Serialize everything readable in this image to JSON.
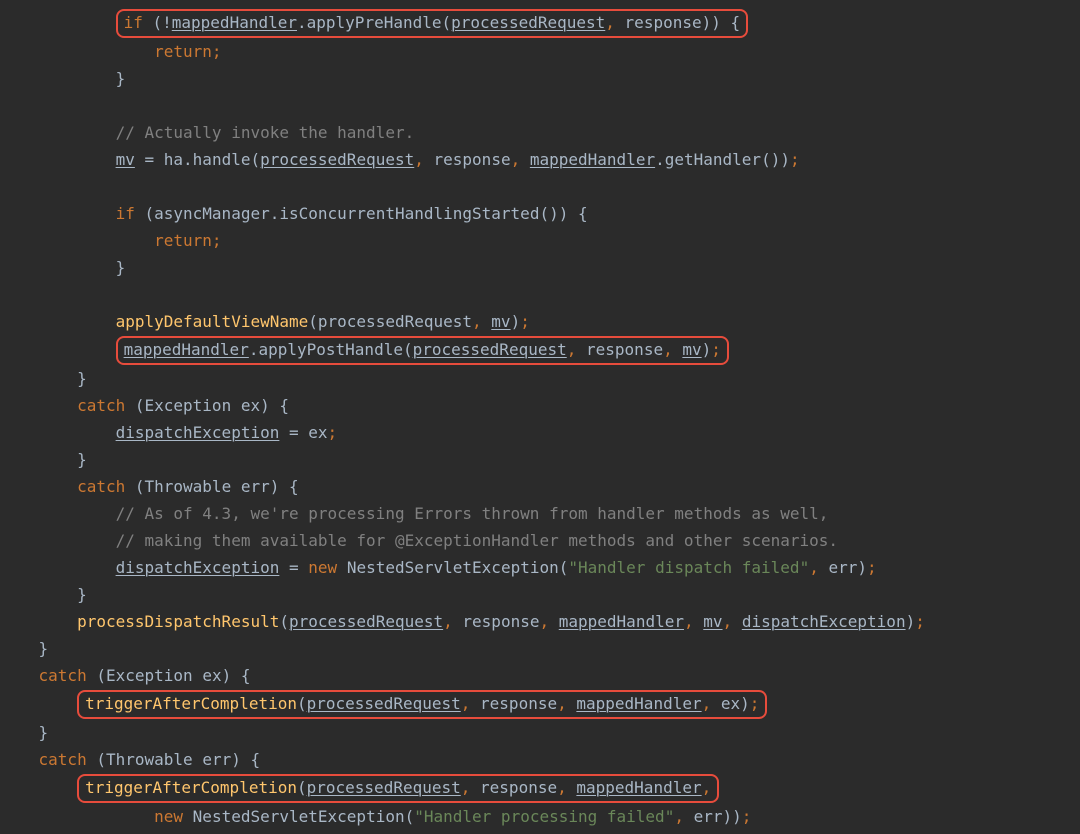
{
  "tokens": {
    "if": "if",
    "return": "return",
    "catch": "catch",
    "new": "new",
    "mappedHandler": "mappedHandler",
    "applyPreHandle": "applyPreHandle",
    "applyPostHandle": "applyPostHandle",
    "applyDefaultViewName": "applyDefaultViewName",
    "processedRequest": "processedRequest",
    "response": "response",
    "mv": "mv",
    "ha": "ha",
    "handle": "handle",
    "getHandler": "getHandler",
    "asyncManager": "asyncManager",
    "isConcurrentHandlingStarted": "isConcurrentHandlingStarted",
    "Exception": "Exception",
    "ex": "ex",
    "Throwable": "Throwable",
    "err": "err",
    "dispatchException": "dispatchException",
    "NestedServletException": "NestedServletException",
    "processDispatchResult": "processDispatchResult",
    "triggerAfterCompletion": "triggerAfterCompletion",
    "cmt1": "// Actually invoke the handler.",
    "cmt2": "// As of 4.3, we're processing Errors thrown from handler methods as well,",
    "cmt3": "// making them available for @ExceptionHandler methods and other scenarios.",
    "str1": "\"Handler dispatch failed\"",
    "str2": "\"Handler processing failed\""
  },
  "indent": {
    "i3": "            ",
    "i4": "                ",
    "i2": "        ",
    "i1": "    ",
    "i0": ""
  }
}
